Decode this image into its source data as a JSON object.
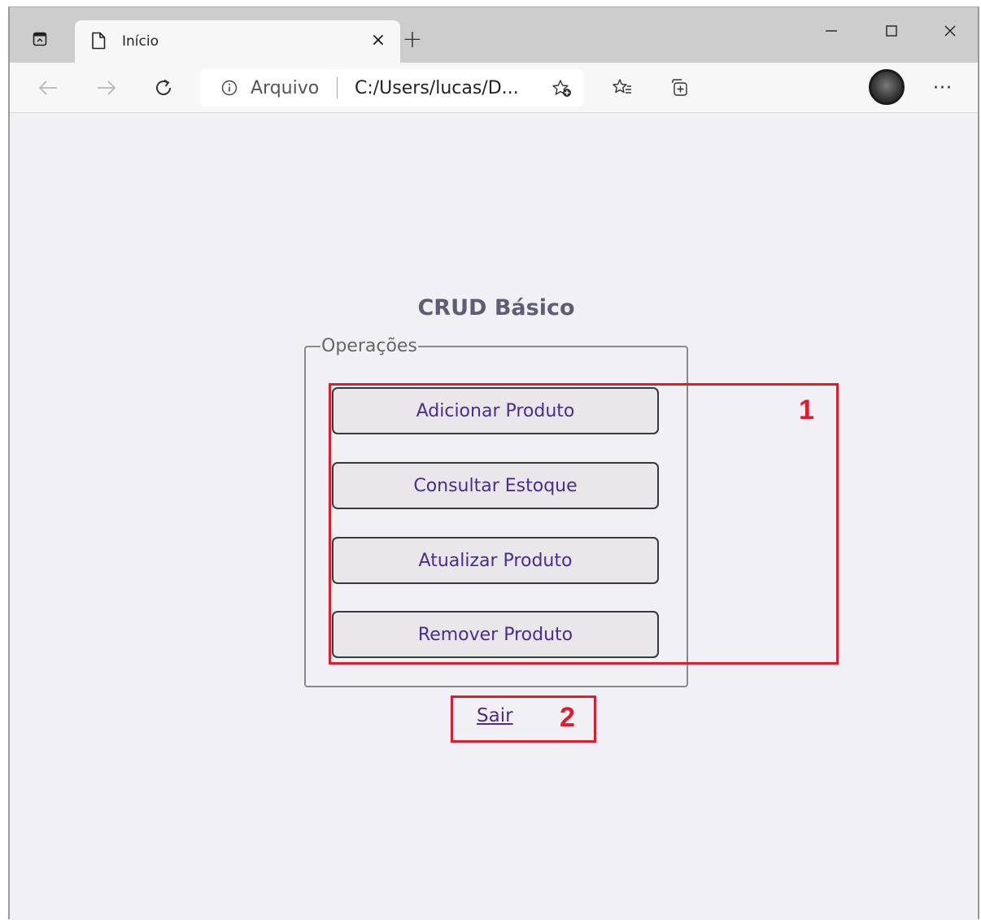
{
  "browser": {
    "tab": {
      "title": "Início",
      "close_label": "×"
    },
    "new_tab_label": "+",
    "address_bar": {
      "scheme_label": "Arquivo",
      "url": "C:/Users/lucas/D..."
    },
    "menu_label": "···"
  },
  "page": {
    "title": "CRUD Básico",
    "fieldset_legend": "Operações",
    "buttons": [
      {
        "label": "Adicionar Produto"
      },
      {
        "label": "Consultar Estoque"
      },
      {
        "label": "Atualizar Produto"
      },
      {
        "label": "Remover Produto"
      }
    ],
    "logout_link": "Sair"
  },
  "annotations": [
    {
      "label": "1"
    },
    {
      "label": "2"
    }
  ],
  "colors": {
    "button_text": "#4b2c8f",
    "annotation": "#e11b2b",
    "page_bg": "#f0f0f5"
  }
}
